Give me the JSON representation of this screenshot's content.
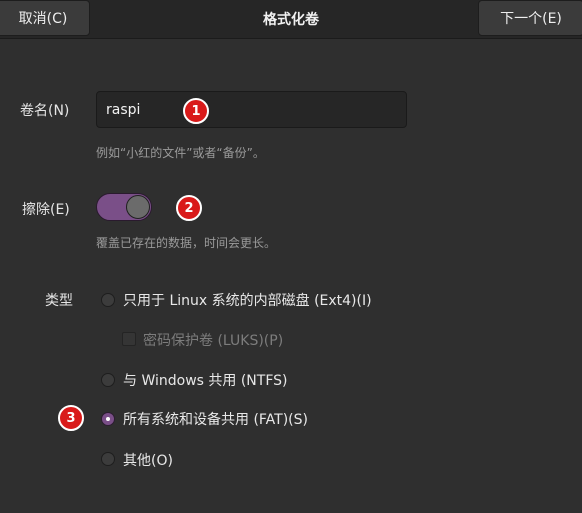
{
  "header": {
    "cancel_label": "取消(C)",
    "title": "格式化卷",
    "next_label": "下一个(E)"
  },
  "volume_name": {
    "label": "卷名(N)",
    "value": "raspi",
    "hint": "例如“小红的文件”或者“备份”。"
  },
  "erase": {
    "label": "擦除(E)",
    "on": true,
    "hint": "覆盖已存在的数据，时间会更长。"
  },
  "type": {
    "label": "类型",
    "options": [
      {
        "label": "只用于 Linux 系统的内部磁盘 (Ext4)(I)",
        "selected": false
      },
      {
        "label": "与 Windows 共用 (NTFS)",
        "selected": false
      },
      {
        "label": "所有系统和设备共用 (FAT)(S)",
        "selected": true
      },
      {
        "label": "其他(O)",
        "selected": false
      }
    ],
    "luks": {
      "label": "密码保护卷 (LUKS)(P)",
      "checked": false,
      "enabled": false
    }
  },
  "badges": [
    "1",
    "2",
    "3"
  ],
  "colors": {
    "accent": "#7a4f88",
    "badge": "#d91a1a",
    "background": "#2f2f2f"
  }
}
